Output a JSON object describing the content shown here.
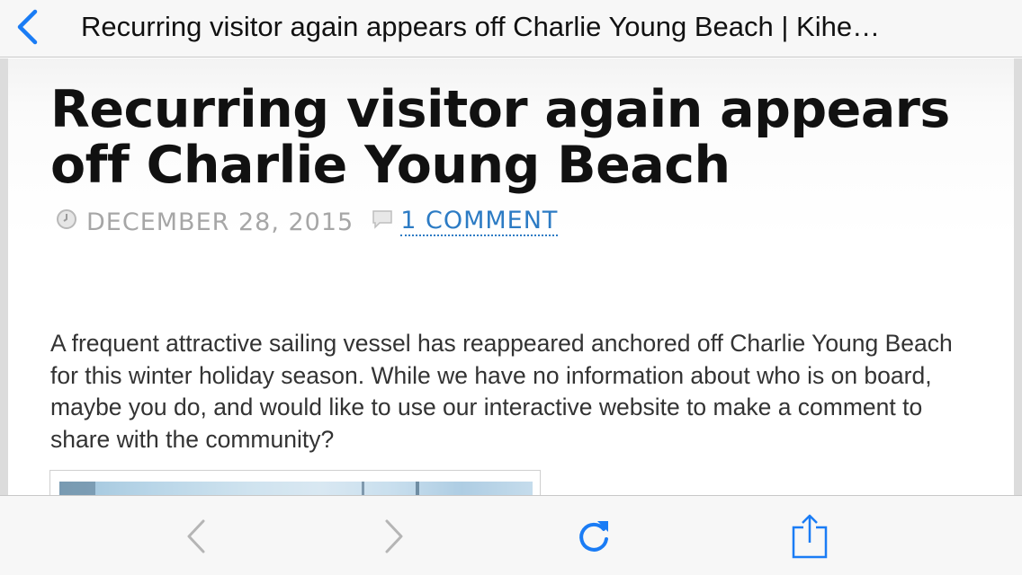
{
  "nav": {
    "title": "Recurring visitor again appears off Charlie Young Beach | Kihe…",
    "back_icon": "chevron-left-icon"
  },
  "article": {
    "title": "Recurring visitor again appears off Charlie Young Beach",
    "date": "DECEMBER 28, 2015",
    "comments_link": "1 COMMENT",
    "body": "A frequent attractive sailing vessel has reappeared anchored off Charlie Young Beach for this winter holiday season. While we have no information about who is on board, maybe you do, and would like to use our interactive website to make a comment to share with the community?"
  },
  "toolbar": {
    "items": [
      "back-icon",
      "forward-icon",
      "reload-icon",
      "share-icon"
    ]
  },
  "colors": {
    "accent": "#1a7cf5",
    "link": "#2c7bc4",
    "disabled": "#b5b5b5"
  }
}
